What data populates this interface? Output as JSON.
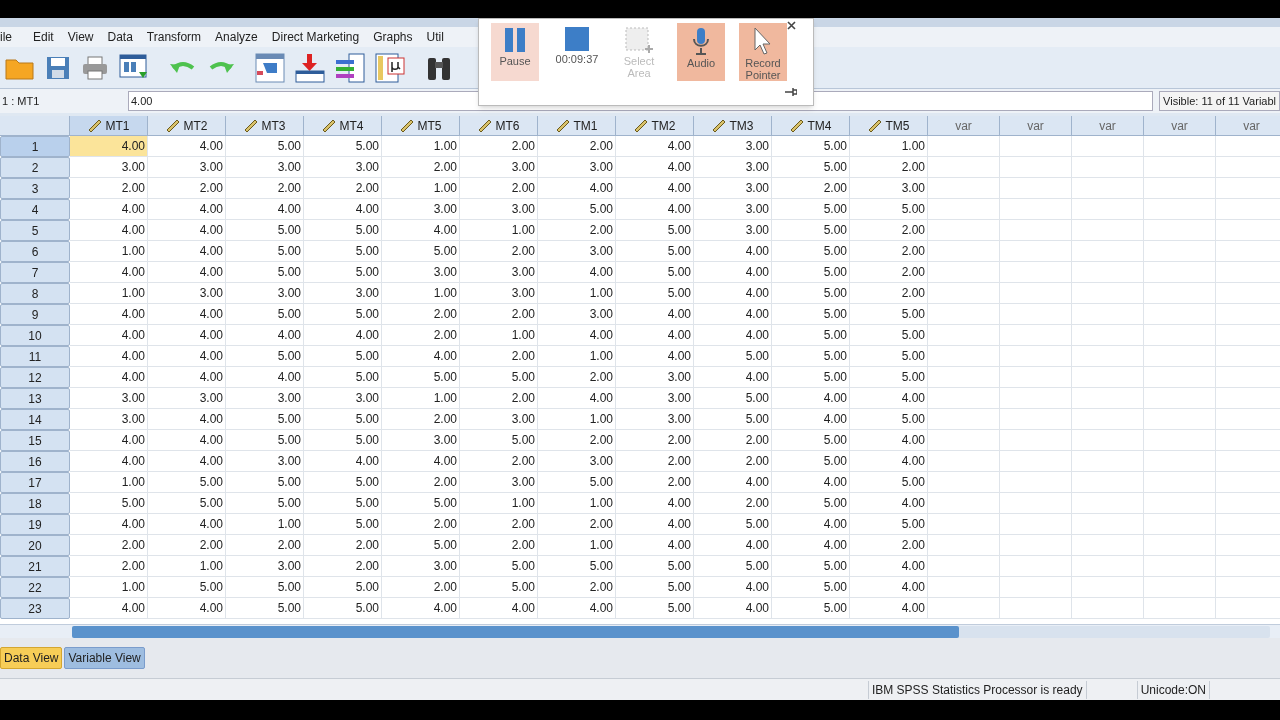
{
  "menu": [
    "ile",
    "Edit",
    "View",
    "Data",
    "Transform",
    "Analyze",
    "Direct Marketing",
    "Graphs",
    "Util"
  ],
  "cell_ref": {
    "name": "1 : MT1",
    "value": "4.00",
    "visible": "Visible: 11 of 11 Variabl"
  },
  "recorder": {
    "items": [
      {
        "kind": "pause",
        "label": "Pause",
        "on": true,
        "disabled": false
      },
      {
        "kind": "stop",
        "label": "00:09:37",
        "on": false,
        "disabled": false
      },
      {
        "kind": "select",
        "label": "Select Area",
        "on": false,
        "disabled": true
      },
      {
        "kind": "audio",
        "label": "Audio",
        "on": true,
        "disabled": false
      },
      {
        "kind": "pointer",
        "label": "Record Pointer",
        "on": true,
        "disabled": false
      }
    ]
  },
  "table": {
    "columns": [
      {
        "label": "MT1",
        "kind": "numeric",
        "selected": true
      },
      {
        "label": "MT2",
        "kind": "numeric",
        "selected": false
      },
      {
        "label": "MT3",
        "kind": "numeric",
        "selected": false
      },
      {
        "label": "MT4",
        "kind": "numeric",
        "selected": false
      },
      {
        "label": "MT5",
        "kind": "numeric",
        "selected": false
      },
      {
        "label": "MT6",
        "kind": "numeric",
        "selected": false
      },
      {
        "label": "TM1",
        "kind": "numeric",
        "selected": false
      },
      {
        "label": "TM2",
        "kind": "numeric",
        "selected": false
      },
      {
        "label": "TM3",
        "kind": "numeric",
        "selected": false
      },
      {
        "label": "TM4",
        "kind": "numeric",
        "selected": false
      },
      {
        "label": "TM5",
        "kind": "numeric",
        "selected": false
      },
      {
        "label": "var",
        "kind": "empty",
        "selected": false
      },
      {
        "label": "var",
        "kind": "empty",
        "selected": false
      },
      {
        "label": "var",
        "kind": "empty",
        "selected": false
      },
      {
        "label": "var",
        "kind": "empty",
        "selected": false
      },
      {
        "label": "var",
        "kind": "empty",
        "selected": false
      }
    ],
    "rows": [
      {
        "label": "1",
        "selected": true,
        "cells": [
          "4.00",
          "4.00",
          "5.00",
          "5.00",
          "1.00",
          "2.00",
          "2.00",
          "4.00",
          "3.00",
          "5.00",
          "1.00"
        ]
      },
      {
        "label": "2",
        "selected": false,
        "cells": [
          "3.00",
          "3.00",
          "3.00",
          "3.00",
          "2.00",
          "3.00",
          "3.00",
          "4.00",
          "3.00",
          "5.00",
          "2.00"
        ]
      },
      {
        "label": "3",
        "selected": false,
        "cells": [
          "2.00",
          "2.00",
          "2.00",
          "2.00",
          "1.00",
          "2.00",
          "4.00",
          "4.00",
          "3.00",
          "2.00",
          "3.00"
        ]
      },
      {
        "label": "4",
        "selected": false,
        "cells": [
          "4.00",
          "4.00",
          "4.00",
          "4.00",
          "3.00",
          "3.00",
          "5.00",
          "4.00",
          "3.00",
          "5.00",
          "5.00"
        ]
      },
      {
        "label": "5",
        "selected": false,
        "cells": [
          "4.00",
          "4.00",
          "5.00",
          "5.00",
          "4.00",
          "1.00",
          "2.00",
          "5.00",
          "3.00",
          "5.00",
          "2.00"
        ]
      },
      {
        "label": "6",
        "selected": false,
        "cells": [
          "1.00",
          "4.00",
          "5.00",
          "5.00",
          "5.00",
          "2.00",
          "3.00",
          "5.00",
          "4.00",
          "5.00",
          "2.00"
        ]
      },
      {
        "label": "7",
        "selected": false,
        "cells": [
          "4.00",
          "4.00",
          "5.00",
          "5.00",
          "3.00",
          "3.00",
          "4.00",
          "5.00",
          "4.00",
          "5.00",
          "2.00"
        ]
      },
      {
        "label": "8",
        "selected": false,
        "cells": [
          "1.00",
          "3.00",
          "3.00",
          "3.00",
          "1.00",
          "3.00",
          "1.00",
          "5.00",
          "4.00",
          "5.00",
          "2.00"
        ]
      },
      {
        "label": "9",
        "selected": false,
        "cells": [
          "4.00",
          "4.00",
          "5.00",
          "5.00",
          "2.00",
          "2.00",
          "3.00",
          "4.00",
          "4.00",
          "5.00",
          "5.00"
        ]
      },
      {
        "label": "10",
        "selected": false,
        "cells": [
          "4.00",
          "4.00",
          "4.00",
          "4.00",
          "2.00",
          "1.00",
          "4.00",
          "4.00",
          "4.00",
          "5.00",
          "5.00"
        ]
      },
      {
        "label": "11",
        "selected": false,
        "cells": [
          "4.00",
          "4.00",
          "5.00",
          "5.00",
          "4.00",
          "2.00",
          "1.00",
          "4.00",
          "5.00",
          "5.00",
          "5.00"
        ]
      },
      {
        "label": "12",
        "selected": false,
        "cells": [
          "4.00",
          "4.00",
          "4.00",
          "5.00",
          "5.00",
          "5.00",
          "2.00",
          "3.00",
          "4.00",
          "5.00",
          "5.00"
        ]
      },
      {
        "label": "13",
        "selected": false,
        "cells": [
          "3.00",
          "3.00",
          "3.00",
          "3.00",
          "1.00",
          "2.00",
          "4.00",
          "3.00",
          "5.00",
          "4.00",
          "4.00"
        ]
      },
      {
        "label": "14",
        "selected": false,
        "cells": [
          "3.00",
          "4.00",
          "5.00",
          "5.00",
          "2.00",
          "3.00",
          "1.00",
          "3.00",
          "5.00",
          "4.00",
          "5.00"
        ]
      },
      {
        "label": "15",
        "selected": false,
        "cells": [
          "4.00",
          "4.00",
          "5.00",
          "5.00",
          "3.00",
          "5.00",
          "2.00",
          "2.00",
          "2.00",
          "5.00",
          "4.00"
        ]
      },
      {
        "label": "16",
        "selected": false,
        "cells": [
          "4.00",
          "4.00",
          "3.00",
          "4.00",
          "4.00",
          "2.00",
          "3.00",
          "2.00",
          "2.00",
          "5.00",
          "4.00"
        ]
      },
      {
        "label": "17",
        "selected": false,
        "cells": [
          "1.00",
          "5.00",
          "5.00",
          "5.00",
          "2.00",
          "3.00",
          "5.00",
          "2.00",
          "4.00",
          "4.00",
          "5.00"
        ]
      },
      {
        "label": "18",
        "selected": false,
        "cells": [
          "5.00",
          "5.00",
          "5.00",
          "5.00",
          "5.00",
          "1.00",
          "1.00",
          "4.00",
          "2.00",
          "5.00",
          "4.00"
        ]
      },
      {
        "label": "19",
        "selected": false,
        "cells": [
          "4.00",
          "4.00",
          "1.00",
          "5.00",
          "2.00",
          "2.00",
          "2.00",
          "4.00",
          "5.00",
          "4.00",
          "5.00"
        ]
      },
      {
        "label": "20",
        "selected": false,
        "cells": [
          "2.00",
          "2.00",
          "2.00",
          "2.00",
          "5.00",
          "2.00",
          "1.00",
          "4.00",
          "4.00",
          "4.00",
          "2.00"
        ]
      },
      {
        "label": "21",
        "selected": false,
        "cells": [
          "2.00",
          "1.00",
          "3.00",
          "2.00",
          "3.00",
          "5.00",
          "5.00",
          "5.00",
          "5.00",
          "5.00",
          "4.00"
        ]
      },
      {
        "label": "22",
        "selected": false,
        "cells": [
          "1.00",
          "5.00",
          "5.00",
          "5.00",
          "2.00",
          "5.00",
          "2.00",
          "5.00",
          "4.00",
          "5.00",
          "4.00"
        ]
      },
      {
        "label": "23",
        "selected": false,
        "cells": [
          "4.00",
          "4.00",
          "5.00",
          "5.00",
          "4.00",
          "4.00",
          "4.00",
          "5.00",
          "4.00",
          "5.00",
          "4.00"
        ]
      }
    ]
  },
  "tabs": [
    {
      "label": "Data View",
      "selected": true
    },
    {
      "label": "Variable View",
      "selected": false
    }
  ],
  "status_bar": [
    "IBM SPSS Statistics Processor is ready",
    "Unicode:ON"
  ]
}
